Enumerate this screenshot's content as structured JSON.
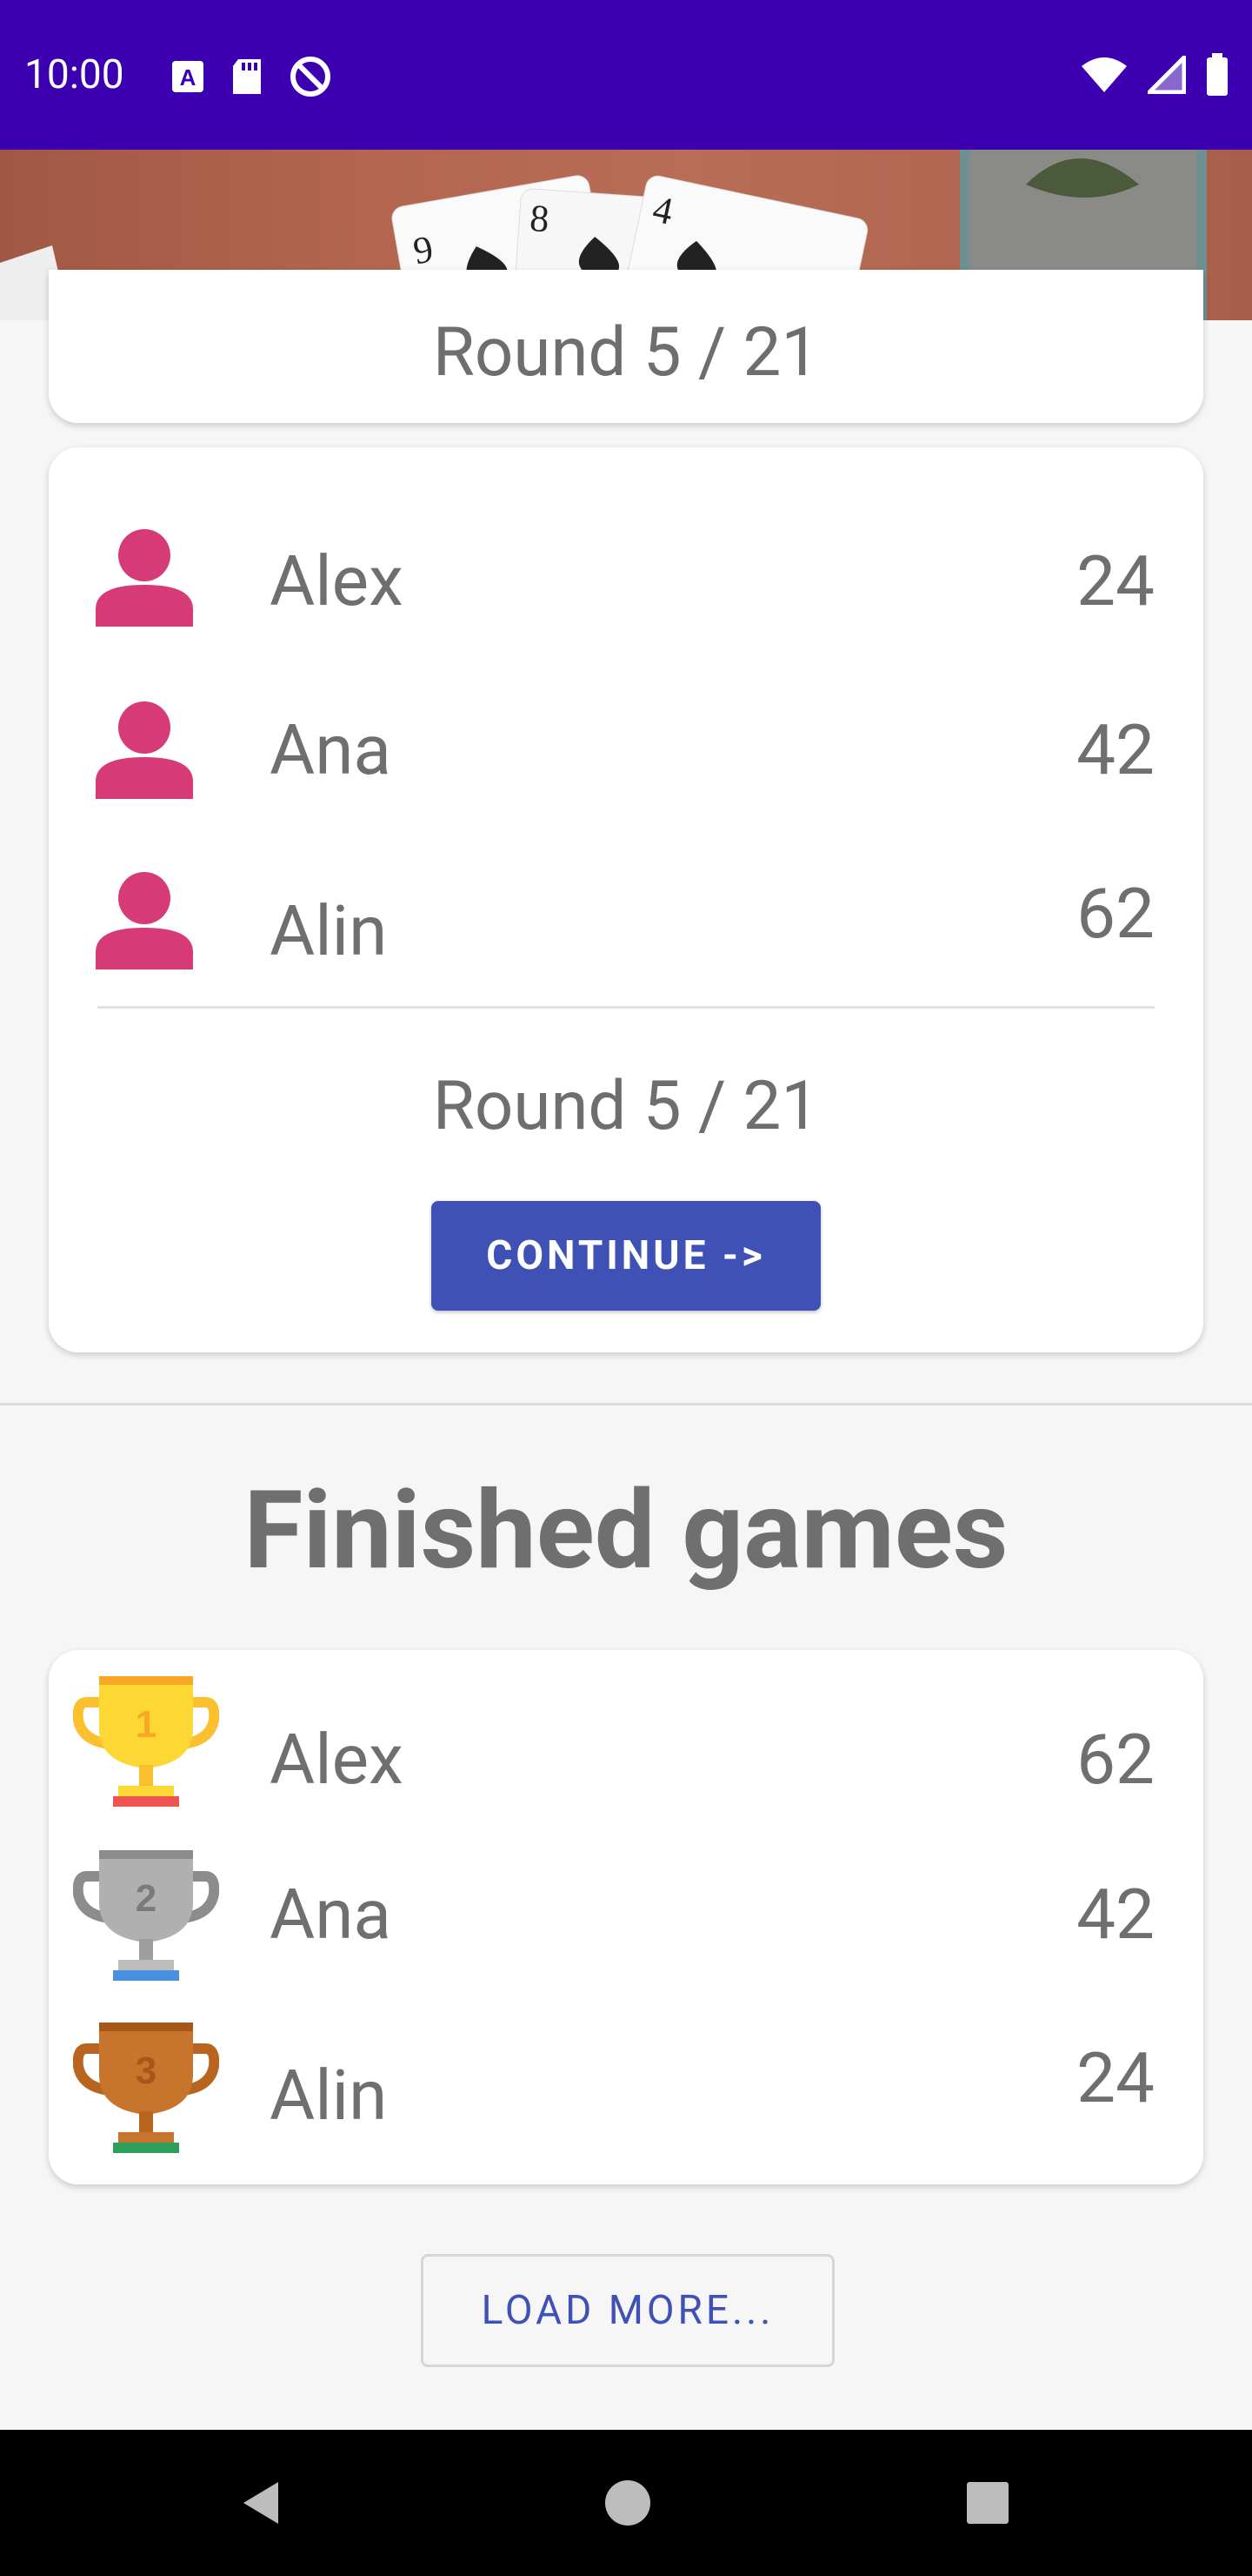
{
  "status_bar": {
    "time": "10:00"
  },
  "current_game": {
    "round_label_top": "Round 5 / 21",
    "players": [
      {
        "name": "Alex",
        "score": "24"
      },
      {
        "name": "Ana",
        "score": "42"
      },
      {
        "name": "Alin",
        "score": "62"
      }
    ],
    "round_label": "Round 5 / 21",
    "continue_label": "CONTINUE ->"
  },
  "finished": {
    "title": "Finished games",
    "players": [
      {
        "name": "Alex",
        "score": "62",
        "place": "1"
      },
      {
        "name": "Ana",
        "score": "42",
        "place": "2"
      },
      {
        "name": "Alin",
        "score": "24",
        "place": "3"
      }
    ],
    "load_more_label": "LOAD MORE..."
  },
  "colors": {
    "status_bar": "#3d00b0",
    "accent": "#3f51b5",
    "person_icon": "#d63b78",
    "gold": "#fdd835",
    "silver": "#9e9e9e",
    "bronze": "#c7752d"
  },
  "icons": {
    "status_left": [
      "a-notification-icon",
      "sd-card-icon",
      "no-disturb-icon"
    ],
    "status_right": [
      "wifi-icon",
      "signal-icon",
      "battery-icon"
    ],
    "nav": [
      "back-icon",
      "home-icon",
      "recents-icon"
    ]
  }
}
